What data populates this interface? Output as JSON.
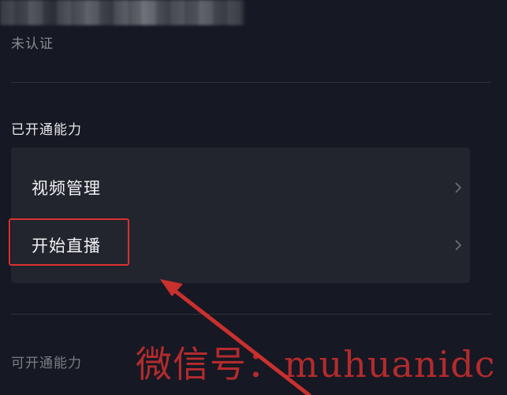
{
  "profile": {
    "verify_status": "未认证"
  },
  "sections": {
    "enabled_title": "已开通能力",
    "available_title": "可开通能力"
  },
  "enabled_items": [
    {
      "label": "视频管理",
      "icon": "chevron-right-icon"
    },
    {
      "label": "开始直播",
      "icon": "chevron-right-icon"
    }
  ],
  "annotation": {
    "highlight_color": "#d9322f",
    "watermark": "微信号：muhuanidc"
  },
  "colors": {
    "background": "#161823",
    "card": "#22242e",
    "text_primary": "#f2f2f4",
    "text_muted": "#8a8b91"
  }
}
